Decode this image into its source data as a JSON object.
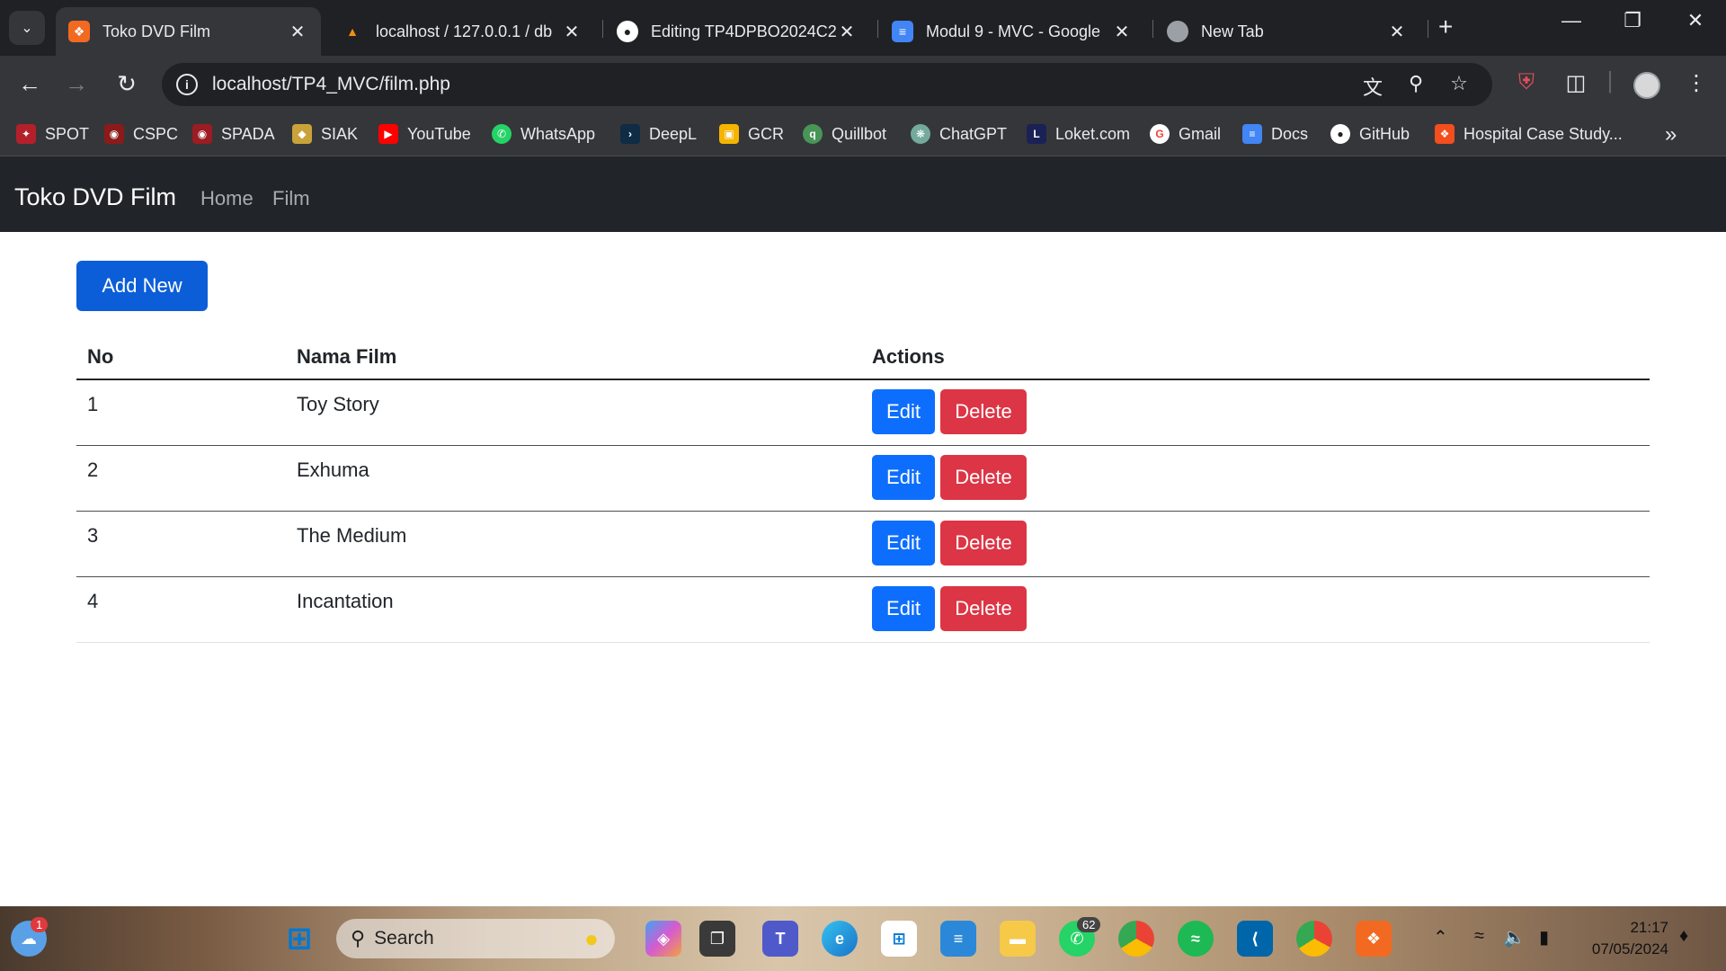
{
  "browser": {
    "tabs": [
      {
        "title": "Toko DVD Film",
        "icon": "xampp-icon",
        "active": true
      },
      {
        "title": "localhost / 127.0.0.1 / db",
        "icon": "phpmyadmin-icon",
        "active": false
      },
      {
        "title": "Editing TP4DPBO2024C2/",
        "icon": "github-icon",
        "active": false
      },
      {
        "title": "Modul 9 - MVC - Google",
        "icon": "google-docs-icon",
        "active": false
      },
      {
        "title": "New Tab",
        "icon": "chrome-icon",
        "active": false
      }
    ],
    "url": "localhost/TP4_MVC/film.php",
    "bookmarks": [
      "SPOT",
      "CSPC",
      "SPADA",
      "SIAK",
      "YouTube",
      "WhatsApp",
      "DeepL",
      "GCR",
      "Quillbot",
      "ChatGPT",
      "Loket.com",
      "Gmail",
      "Docs",
      "GitHub",
      "Hospital Case Study..."
    ]
  },
  "navbar": {
    "brand": "Toko DVD Film",
    "links": [
      "Home",
      "Film"
    ]
  },
  "page": {
    "add_button": "Add New",
    "columns": [
      "No",
      "Nama Film",
      "Actions"
    ],
    "rows": [
      {
        "no": "1",
        "name": "Toy Story"
      },
      {
        "no": "2",
        "name": "Exhuma"
      },
      {
        "no": "3",
        "name": "The Medium"
      },
      {
        "no": "4",
        "name": "Incantation"
      }
    ],
    "edit_label": "Edit",
    "delete_label": "Delete"
  },
  "taskbar": {
    "search_placeholder": "Search",
    "weather_badge": "1",
    "whatsapp_badge": "62",
    "time": "21:17",
    "date": "07/05/2024"
  },
  "colors": {
    "navbar_bg": "#212529",
    "primary": "#0d6efd",
    "danger": "#dc3545"
  }
}
